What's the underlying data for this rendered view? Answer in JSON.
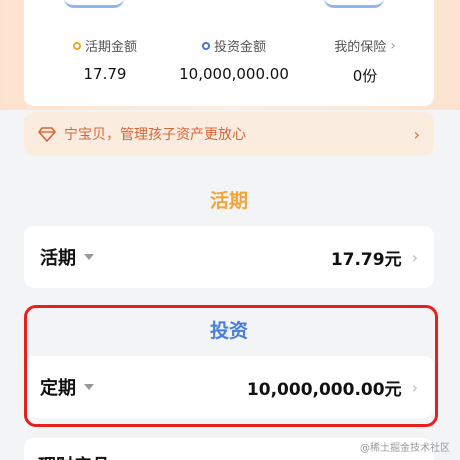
{
  "summary": {
    "current": {
      "label": "活期金额",
      "value": "17.79"
    },
    "investment": {
      "label": "投资金额",
      "value": "10,000,000.00"
    },
    "insurance": {
      "label": "我的保险",
      "value": "0份"
    }
  },
  "banner": {
    "text": "宁宝贝，管理孩子资产更放心",
    "icon": "diamond-icon"
  },
  "sections": {
    "current_title": "活期",
    "current_row": {
      "name": "活期",
      "amount": "17.79元"
    },
    "invest_title": "投资",
    "fixed_row": {
      "name": "定期",
      "amount": "10,000,000.00元"
    },
    "next_row_partial": "理财产品"
  },
  "watermark": "@稀土掘金技术社区",
  "colors": {
    "orange": "#f2a53b",
    "blue": "#4a7fd8",
    "highlight": "#e8201c",
    "banner_text": "#d8653a"
  }
}
